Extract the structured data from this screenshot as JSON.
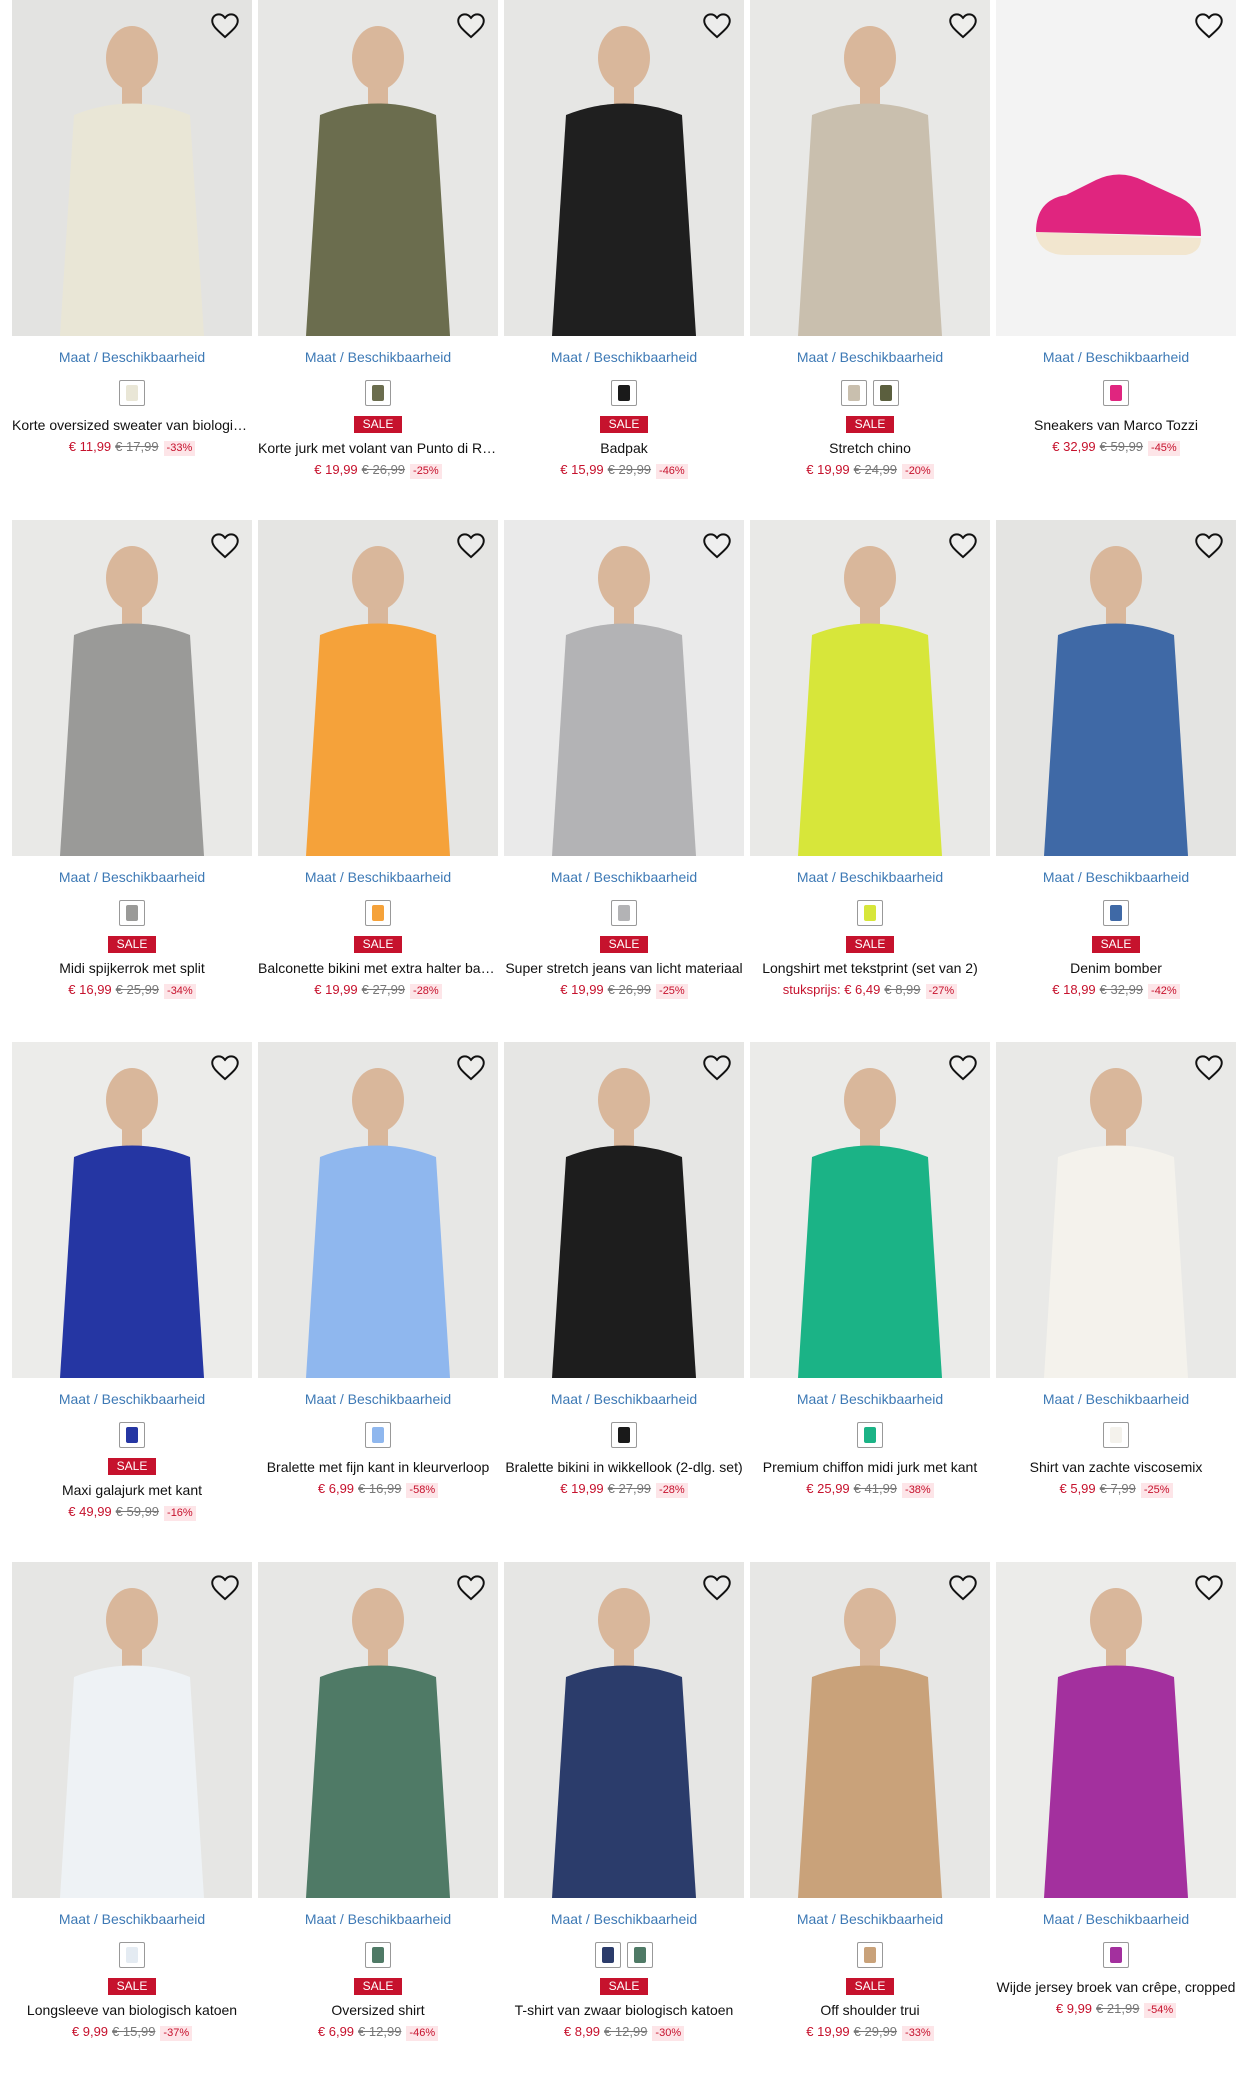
{
  "size_link_label": "Maat / Beschikbaarheid",
  "sale_label": "SALE",
  "accent_color": "#c6122d",
  "link_color": "#3d79b5",
  "products": [
    {
      "name": "Korte oversized sweater van biologisch katoen",
      "price": "€ 11,99",
      "old_price": "€ 17,99",
      "discount": "-33%",
      "sale": false,
      "swatches": [
        "#e9e6d6"
      ],
      "photo_bg": "#e3e3e1",
      "garment": "#e9e6d6",
      "icon": "heart-icon"
    },
    {
      "name": "Korte jurk met volant van Punto di Roma",
      "price": "€ 19,99",
      "old_price": "€ 26,99",
      "discount": "-25%",
      "sale": true,
      "swatches": [
        "#6b6d4e"
      ],
      "photo_bg": "#e7e7e5",
      "garment": "#6b6d4e",
      "icon": "heart-icon"
    },
    {
      "name": "Badpak",
      "price": "€ 15,99",
      "old_price": "€ 29,99",
      "discount": "-46%",
      "sale": true,
      "swatches": [
        "#1a1a1a"
      ],
      "photo_bg": "#e6e6e4",
      "garment": "#1f1f1f",
      "icon": "heart-icon"
    },
    {
      "name": "Stretch chino",
      "price": "€ 19,99",
      "old_price": "€ 24,99",
      "discount": "-20%",
      "sale": true,
      "swatches": [
        "#c9bfae",
        "#5b5f3e"
      ],
      "photo_bg": "#e8e8e6",
      "garment": "#c9bfae",
      "icon": "heart-icon"
    },
    {
      "name": "Sneakers van Marco Tozzi",
      "price": "€ 32,99",
      "old_price": "€ 59,99",
      "discount": "-45%",
      "sale": false,
      "swatches": [
        "#e0257f"
      ],
      "photo_bg": "#f3f3f3",
      "garment": "#e0257f",
      "icon": "heart-icon"
    },
    {
      "name": "Midi spijkerrok met split",
      "price": "€ 16,99",
      "old_price": "€ 25,99",
      "discount": "-34%",
      "sale": true,
      "swatches": [
        "#9a9a98"
      ],
      "photo_bg": "#e9e9e7",
      "garment": "#9a9a98",
      "icon": "heart-icon"
    },
    {
      "name": "Balconette bikini met extra halter bandjes",
      "price": "€ 19,99",
      "old_price": "€ 27,99",
      "discount": "-28%",
      "sale": true,
      "swatches": [
        "#f5a23a"
      ],
      "photo_bg": "#e5e5e3",
      "garment": "#f5a23a",
      "icon": "heart-icon"
    },
    {
      "name": "Super stretch jeans van licht materiaal",
      "price": "€ 19,99",
      "old_price": "€ 26,99",
      "discount": "-25%",
      "sale": true,
      "swatches": [
        "#b3b3b5"
      ],
      "photo_bg": "#eaeaea",
      "garment": "#b3b3b5",
      "icon": "heart-icon"
    },
    {
      "name": "Longshirt met tekstprint (set van 2)",
      "price": "€ 6,49",
      "old_price": "€ 8,99",
      "discount": "-27%",
      "unit_label": "stuksprijs:",
      "sale": true,
      "swatches": [
        "#d7e63a"
      ],
      "photo_bg": "#e9e9e7",
      "garment": "#d7e63a",
      "icon": "heart-icon"
    },
    {
      "name": "Denim bomber",
      "price": "€ 18,99",
      "old_price": "€ 32,99",
      "discount": "-42%",
      "sale": true,
      "swatches": [
        "#3f69a6"
      ],
      "photo_bg": "#e4e4e2",
      "garment": "#3f69a6",
      "icon": "heart-icon"
    },
    {
      "name": "Maxi galajurk met kant",
      "price": "€ 49,99",
      "old_price": "€ 59,99",
      "discount": "-16%",
      "sale": true,
      "swatches": [
        "#2536a3"
      ],
      "photo_bg": "#ececea",
      "garment": "#2536a3",
      "icon": "heart-icon"
    },
    {
      "name": "Bralette met fijn kant in kleurverloop",
      "price": "€ 6,99",
      "old_price": "€ 16,99",
      "discount": "-58%",
      "sale": false,
      "swatches": [
        "#8fb7ee"
      ],
      "photo_bg": "#e7e7e5",
      "garment": "#8fb7ee",
      "icon": "heart-icon"
    },
    {
      "name": "Bralette bikini in wikkellook (2-dlg. set)",
      "price": "€ 19,99",
      "old_price": "€ 27,99",
      "discount": "-28%",
      "sale": false,
      "swatches": [
        "#1a1a1a"
      ],
      "photo_bg": "#e6e6e4",
      "garment": "#1d1d1d",
      "icon": "heart-icon"
    },
    {
      "name": "Premium chiffon midi jurk met kant",
      "price": "€ 25,99",
      "old_price": "€ 41,99",
      "discount": "-38%",
      "sale": false,
      "swatches": [
        "#1bb386"
      ],
      "photo_bg": "#ebebe9",
      "garment": "#1bb386",
      "icon": "heart-icon"
    },
    {
      "name": "Shirt van zachte viscosemix",
      "price": "€ 5,99",
      "old_price": "€ 7,99",
      "discount": "-25%",
      "sale": false,
      "swatches": [
        "#f4f2ec"
      ],
      "photo_bg": "#e9e9e7",
      "garment": "#f4f2ec",
      "icon": "heart-icon"
    },
    {
      "name": "Longsleeve van biologisch katoen",
      "price": "€ 9,99",
      "old_price": "€ 15,99",
      "discount": "-37%",
      "sale": true,
      "swatches": [
        "#e4ebf2"
      ],
      "photo_bg": "#e6e6e4",
      "garment": "#eef2f5",
      "icon": "heart-icon"
    },
    {
      "name": "Oversized shirt",
      "price": "€ 6,99",
      "old_price": "€ 12,99",
      "discount": "-46%",
      "sale": true,
      "swatches": [
        "#4f7a66"
      ],
      "photo_bg": "#e7e7e5",
      "garment": "#4f7a66",
      "icon": "heart-icon"
    },
    {
      "name": "T-shirt van zwaar biologisch katoen",
      "price": "€ 8,99",
      "old_price": "€ 12,99",
      "discount": "-30%",
      "sale": true,
      "swatches": [
        "#2b3c6b",
        "#4f7a66"
      ],
      "photo_bg": "#e6e6e4",
      "garment": "#2b3c6b",
      "icon": "heart-icon"
    },
    {
      "name": "Off shoulder trui",
      "price": "€ 19,99",
      "old_price": "€ 29,99",
      "discount": "-33%",
      "sale": true,
      "swatches": [
        "#c9a27a"
      ],
      "photo_bg": "#e7e7e5",
      "garment": "#c9a27a",
      "icon": "heart-icon"
    },
    {
      "name": "Wijde jersey broek van crêpe, cropped",
      "price": "€ 9,99",
      "old_price": "€ 21,99",
      "discount": "-54%",
      "sale": false,
      "swatches": [
        "#a3309e"
      ],
      "photo_bg": "#ececea",
      "garment": "#a3309e",
      "icon": "heart-icon"
    }
  ]
}
